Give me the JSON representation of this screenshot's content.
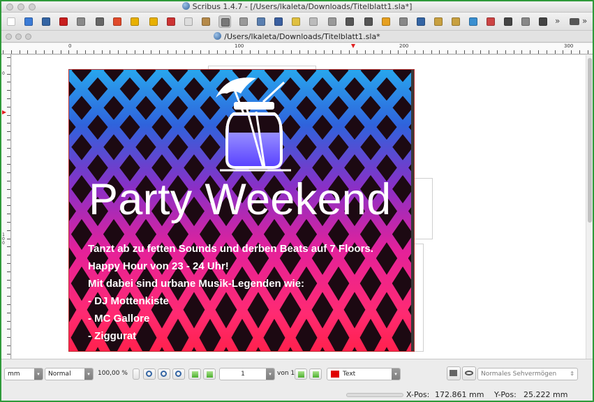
{
  "window": {
    "title": "Scribus 1.4.7 - [/Users/lkaleta/Downloads/Titelblatt1.sla*]"
  },
  "document_tab": {
    "title": "/Users/lkaleta/Downloads/Titelblatt1.sla*"
  },
  "ruler": {
    "h_labels": [
      "0",
      "100",
      "200",
      "300"
    ],
    "v_labels": [
      "0",
      "1 0 0"
    ]
  },
  "toolbar": {
    "icons": [
      "new-document-icon",
      "open-icon",
      "save-icon",
      "close-document-icon",
      "print-icon",
      "preflight-icon",
      "export-pdf-icon",
      "undo-icon",
      "redo-icon",
      "cut-icon",
      "copy-icon",
      "paste-icon",
      "select-icon",
      "text-frame-icon",
      "image-frame-icon",
      "render-frame-icon",
      "table-icon",
      "shape-icon",
      "polygon-icon",
      "line-icon",
      "bezier-icon",
      "freehand-icon",
      "rotate-icon",
      "zoom-icon",
      "edit-contents-icon",
      "edit-text-icon",
      "link-frames-icon",
      "unlink-frames-icon",
      "measure-icon",
      "copy-properties-icon",
      "eyedropper-icon"
    ],
    "more_label": "»"
  },
  "poster": {
    "headline": "Party Weekend",
    "lines": [
      "Tanzt ab zu fetten Sounds und derben Beats auf 7 Floors.",
      "Happy Hour von 23 - 24 Uhr!",
      "Mit dabei sind urbane Musik-Legenden wie:",
      "- DJ Mottenkiste",
      "- MC Gallore",
      "- Ziggurat"
    ]
  },
  "status": {
    "unit": "mm",
    "style": "Normal",
    "zoom": "100,00 %",
    "page_number": "1",
    "page_of": "von 1",
    "layer": "Text",
    "layer_color": "#e00000",
    "vision": "Normales Sehvermögen",
    "x_label": "X-Pos:",
    "x_value": "172.861 mm",
    "y_label": "Y-Pos:",
    "y_value": "25.222 mm"
  }
}
